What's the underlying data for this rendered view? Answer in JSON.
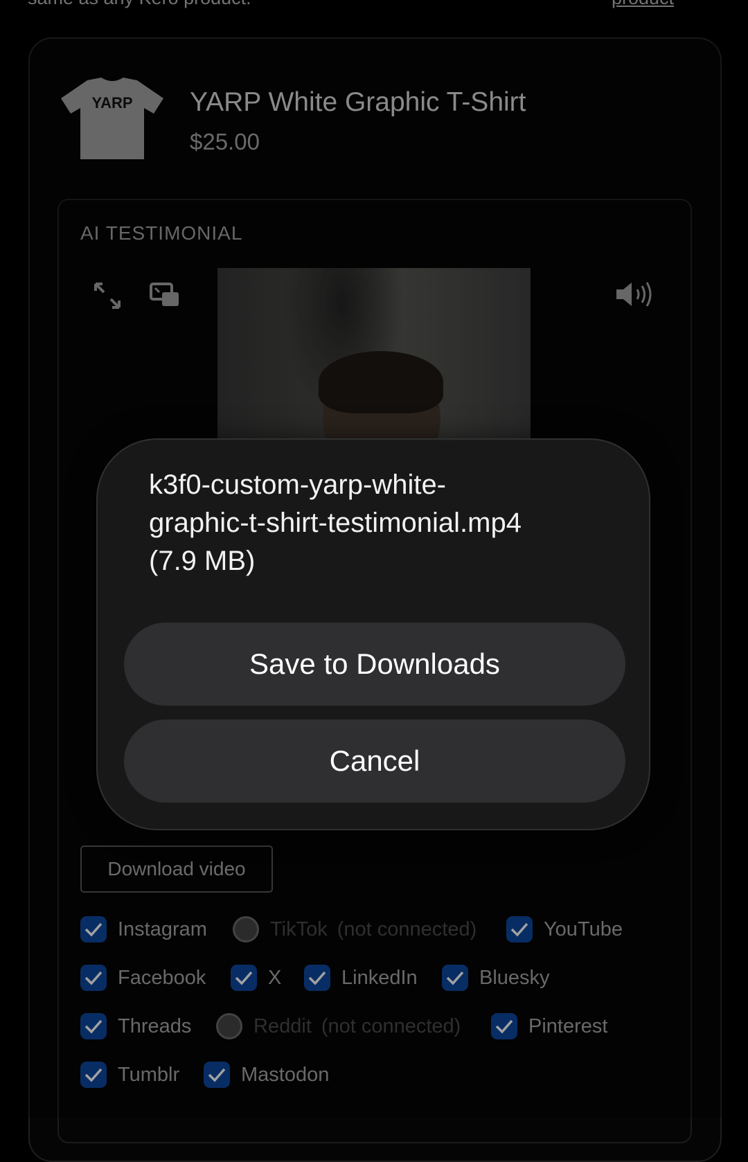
{
  "top_partial": {
    "text": "same as any Kero product.",
    "link": "product"
  },
  "product": {
    "name": "YARP White Graphic T-Shirt",
    "price": "$25.00",
    "shirt_text": "YARP"
  },
  "testimonial": {
    "label": "AI TESTIMONIAL"
  },
  "download_button": "Download video",
  "platforms": [
    {
      "label": "Instagram",
      "checked": true
    },
    {
      "label": "TikTok",
      "note": "(not connected)",
      "checked": false
    },
    {
      "label": "YouTube",
      "checked": true
    },
    {
      "label": "Facebook",
      "checked": true
    },
    {
      "label": "X",
      "checked": true
    },
    {
      "label": "LinkedIn",
      "checked": true
    },
    {
      "label": "Bluesky",
      "checked": true
    },
    {
      "label": "Threads",
      "checked": true
    },
    {
      "label": "Reddit",
      "note": "(not connected)",
      "checked": false
    },
    {
      "label": "Pinterest",
      "checked": true
    },
    {
      "label": "Tumblr",
      "checked": true
    },
    {
      "label": "Mastodon",
      "checked": true
    }
  ],
  "dialog": {
    "filename": "k3f0-custom-yarp-white-graphic-t-shirt-testimonial.mp4",
    "filename_line1": "k3f0-custom-yarp-white-",
    "filename_line2": "graphic-t-shirt-testimonial.mp4",
    "size": "(7.9 MB)",
    "save_label": "Save to Downloads",
    "cancel_label": "Cancel"
  },
  "colors": {
    "checkbox_checked": "#0b3c86",
    "sheet_bg": "#1a1a1b",
    "sheet_button": "#2f2f31"
  },
  "icons": [
    "expand-icon",
    "picture-in-picture-icon",
    "volume-icon",
    "checkmark-icon"
  ]
}
